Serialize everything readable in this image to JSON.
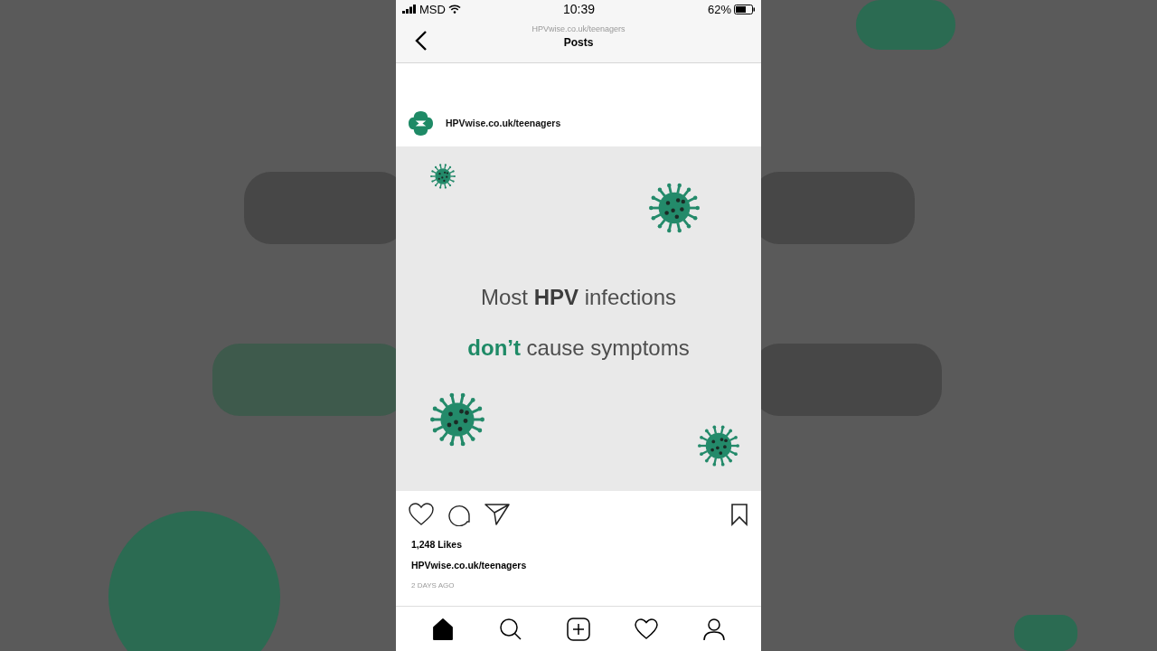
{
  "status_bar": {
    "carrier": "MSD",
    "time": "10:39",
    "battery": "62%"
  },
  "header": {
    "subtitle": "HPVwise.co.uk/teenagers",
    "title": "Posts"
  },
  "post": {
    "account": "HPVwise.co.uk/teenagers",
    "slide": {
      "lines": [
        {
          "text": "Most **HPV** infections",
          "kind": "plain"
        },
        {
          "text": "**don’t** cause symptoms",
          "kind": "accent"
        }
      ]
    },
    "likes": "1,248 Likes",
    "caption_account": "HPVwise.co.uk/teenagers",
    "time": "2 DAYS AGO"
  },
  "nav": [
    {
      "kind": "home",
      "selected": true
    },
    {
      "kind": "search",
      "selected": false
    },
    {
      "kind": "add",
      "selected": false
    },
    {
      "kind": "activity",
      "selected": false
    },
    {
      "kind": "profile",
      "selected": false
    }
  ]
}
